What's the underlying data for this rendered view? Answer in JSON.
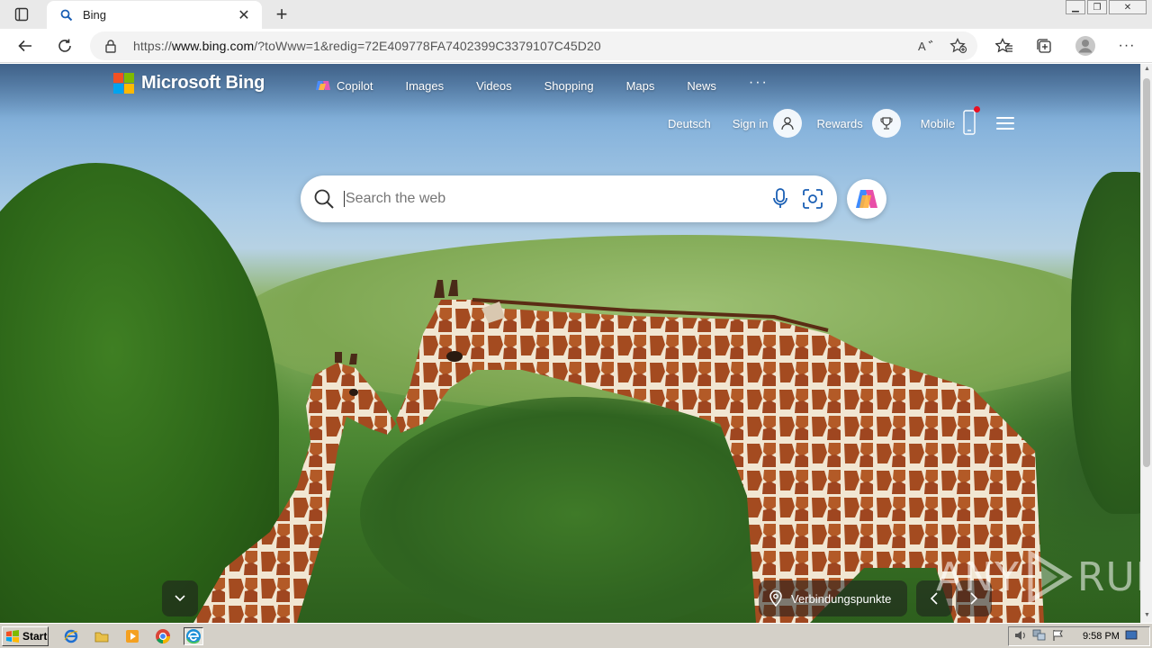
{
  "browser": {
    "tab_title": "Bing",
    "url_prefix": "https://",
    "url_host": "www.bing.com",
    "url_rest": "/?toWww=1&redig=72E409778FA7402399C3379107C45D20"
  },
  "bing": {
    "logo_text": "Microsoft Bing",
    "nav": {
      "copilot": "Copilot",
      "images": "Images",
      "videos": "Videos",
      "shopping": "Shopping",
      "maps": "Maps",
      "news": "News",
      "more": "···"
    },
    "header": {
      "language": "Deutsch",
      "sign_in": "Sign in",
      "rewards": "Rewards",
      "mobile": "Mobile"
    },
    "search": {
      "placeholder": "Search the web"
    },
    "location_label": "Verbindungspunkte",
    "colors": {
      "logo_red": "#f25022",
      "logo_green": "#7fba00",
      "logo_blue": "#00a4ef",
      "logo_yellow": "#ffb900",
      "notification_dot": "#e81123"
    }
  },
  "watermark": {
    "left": "ANY",
    "right": "RUN"
  },
  "taskbar": {
    "start_label": "Start",
    "time": "9:58 PM"
  }
}
